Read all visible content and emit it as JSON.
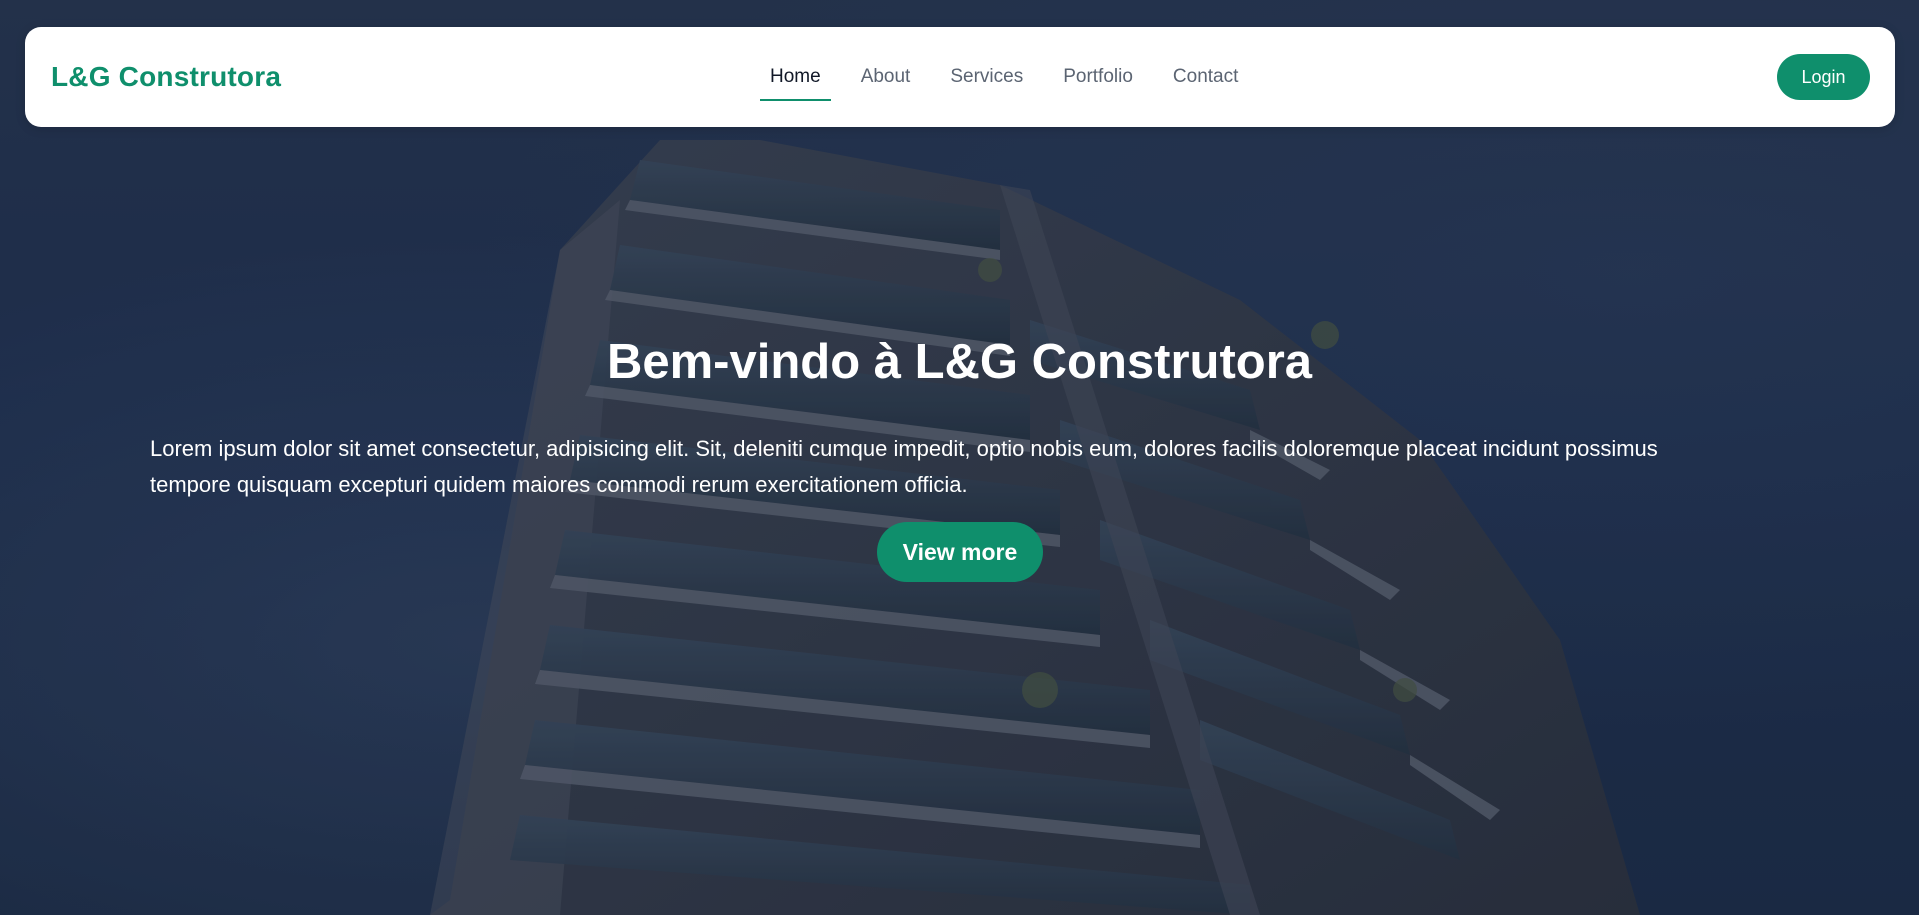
{
  "brand": {
    "name": "L&G Construtora",
    "accent_color": "#0f8f6c"
  },
  "nav": {
    "items": [
      {
        "label": "Home",
        "active": true
      },
      {
        "label": "About",
        "active": false
      },
      {
        "label": "Services",
        "active": false
      },
      {
        "label": "Portfolio",
        "active": false
      },
      {
        "label": "Contact",
        "active": false
      }
    ],
    "login_label": "Login"
  },
  "hero": {
    "title": "Bem-vindo à L&G Construtora",
    "text": "Lorem ipsum dolor sit amet consectetur, adipisicing elit. Sit, deleniti cumque impedit, optio nobis eum, dolores facilis doloremque placeat incidunt possimus tempore quisquam excepturi quidem maiores commodi rerum exercitationem officia.",
    "button_label": "View more"
  }
}
